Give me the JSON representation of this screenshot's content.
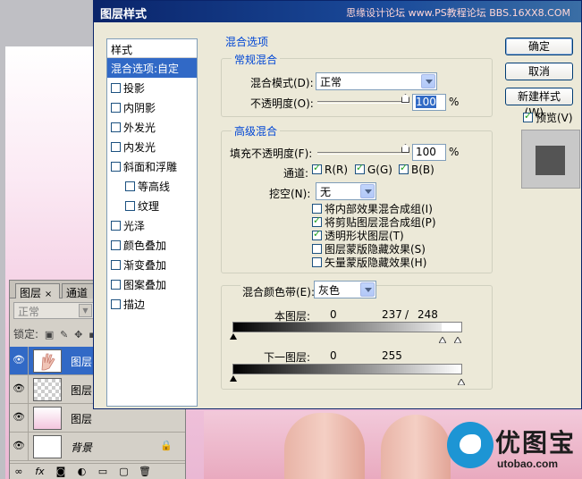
{
  "watermark": "思缘设计论坛 www.PS教程论坛 BBS.16XX8.COM",
  "dialog": {
    "title": "图层样式",
    "buttons": {
      "ok": "确定",
      "cancel": "取消",
      "new_style": "新建样式(W)...",
      "preview": "预览(V)"
    },
    "styles_header": "样式",
    "style_items": [
      {
        "label": "混合选项:自定",
        "checkbox": false,
        "active": true,
        "sub": false
      },
      {
        "label": "投影",
        "checkbox": true,
        "checked": false,
        "sub": false
      },
      {
        "label": "内阴影",
        "checkbox": true,
        "checked": false,
        "sub": false
      },
      {
        "label": "外发光",
        "checkbox": true,
        "checked": false,
        "sub": false
      },
      {
        "label": "内发光",
        "checkbox": true,
        "checked": false,
        "sub": false
      },
      {
        "label": "斜面和浮雕",
        "checkbox": true,
        "checked": false,
        "sub": false
      },
      {
        "label": "等高线",
        "checkbox": true,
        "checked": false,
        "sub": true
      },
      {
        "label": "纹理",
        "checkbox": true,
        "checked": false,
        "sub": true
      },
      {
        "label": "光泽",
        "checkbox": true,
        "checked": false,
        "sub": false
      },
      {
        "label": "颜色叠加",
        "checkbox": true,
        "checked": false,
        "sub": false
      },
      {
        "label": "渐变叠加",
        "checkbox": true,
        "checked": false,
        "sub": false
      },
      {
        "label": "图案叠加",
        "checkbox": true,
        "checked": false,
        "sub": false
      },
      {
        "label": "描边",
        "checkbox": true,
        "checked": false,
        "sub": false
      }
    ],
    "blend_options_title": "混合选项",
    "general": {
      "title": "常规混合",
      "mode_label": "混合模式(D):",
      "mode_value": "正常",
      "opacity_label": "不透明度(O):",
      "opacity_value": "100",
      "percent": "%"
    },
    "advanced": {
      "title": "高级混合",
      "fill_label": "填充不透明度(F):",
      "fill_value": "100",
      "percent": "%",
      "channels_label": "通道:",
      "channels": [
        {
          "label": "R(R)",
          "checked": true
        },
        {
          "label": "G(G)",
          "checked": true
        },
        {
          "label": "B(B)",
          "checked": true
        }
      ],
      "knockout_label": "挖空(N):",
      "knockout_value": "无",
      "options": [
        {
          "label": "将内部效果混合成组(I)",
          "checked": false
        },
        {
          "label": "将剪贴图层混合成组(P)",
          "checked": true
        },
        {
          "label": "透明形状图层(T)",
          "checked": true
        },
        {
          "label": "图层蒙版隐藏效果(S)",
          "checked": false
        },
        {
          "label": "矢量蒙版隐藏效果(H)",
          "checked": false
        }
      ]
    },
    "blend_if": {
      "label": "混合颜色带(E):",
      "value": "灰色",
      "this_layer_label": "本图层:",
      "this_layer_low": "0",
      "this_layer_high_a": "237",
      "this_layer_sep": "/",
      "this_layer_high_b": "248",
      "under_layer_label": "下一图层:",
      "under_layer_low": "0",
      "under_layer_high": "255"
    }
  },
  "layers_panel": {
    "tabs": [
      "图层",
      "通道"
    ],
    "blend_mode": "正常",
    "lock_label": "锁定:",
    "layers": [
      {
        "name": "图层",
        "thumb": "hand",
        "selected": true,
        "italic": false,
        "locked": false
      },
      {
        "name": "图层",
        "thumb": "checker",
        "selected": false,
        "italic": false,
        "locked": false
      },
      {
        "name": "图层",
        "thumb": "pink",
        "selected": false,
        "italic": false,
        "locked": false
      },
      {
        "name": "背景",
        "thumb": "white",
        "selected": false,
        "italic": true,
        "locked": true
      }
    ],
    "footer_icons": [
      "link-icon",
      "fx-icon",
      "mask-icon",
      "adjustment-icon",
      "group-icon",
      "new-layer-icon",
      "trash-icon"
    ]
  },
  "logo": {
    "name": "优图宝",
    "url": "utobao.com"
  }
}
